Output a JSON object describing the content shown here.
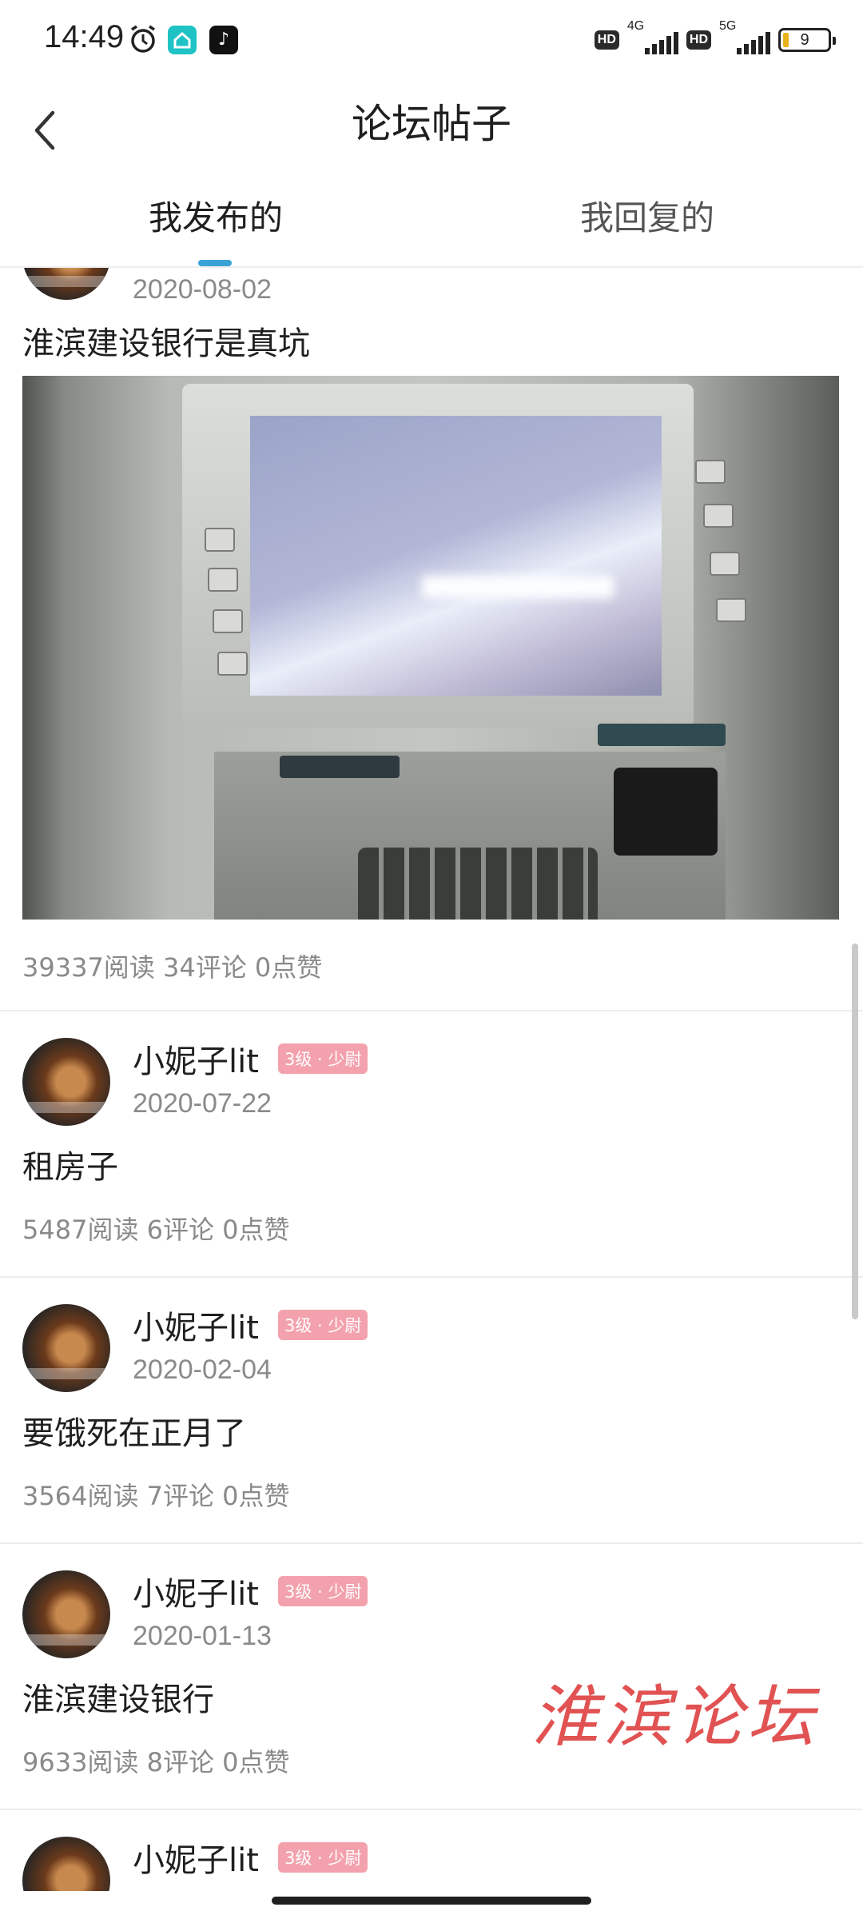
{
  "status_bar": {
    "time": "14:49",
    "hd1": "HD",
    "net1": "4G",
    "hd2": "HD",
    "net2": "5G",
    "battery": "9"
  },
  "header": {
    "title": "论坛帖子"
  },
  "tabs": [
    {
      "label": "我发布的",
      "active": true
    },
    {
      "label": "我回复的",
      "active": false
    }
  ],
  "posts": [
    {
      "date": "2020-08-02",
      "title": "淮滨建设银行是真坑",
      "stats": "39337阅读 34评论 0点赞"
    },
    {
      "username": "小妮子lit",
      "badge": "3级 · 少尉",
      "date": "2020-07-22",
      "title": "租房子",
      "stats": "5487阅读 6评论 0点赞"
    },
    {
      "username": "小妮子lit",
      "badge": "3级 · 少尉",
      "date": "2020-02-04",
      "title": "要饿死在正月了",
      "stats": "3564阅读 7评论 0点赞"
    },
    {
      "username": "小妮子lit",
      "badge": "3级 · 少尉",
      "date": "2020-01-13",
      "title": "淮滨建设银行",
      "stats": "9633阅读 8评论 0点赞"
    },
    {
      "username": "小妮子lit",
      "badge": "3级 · 少尉"
    }
  ],
  "watermark": "淮滨论坛",
  "colors": {
    "tab_indicator": "#3aa3d6",
    "badge": "#f3a2ad",
    "watermark": "#e15252"
  }
}
